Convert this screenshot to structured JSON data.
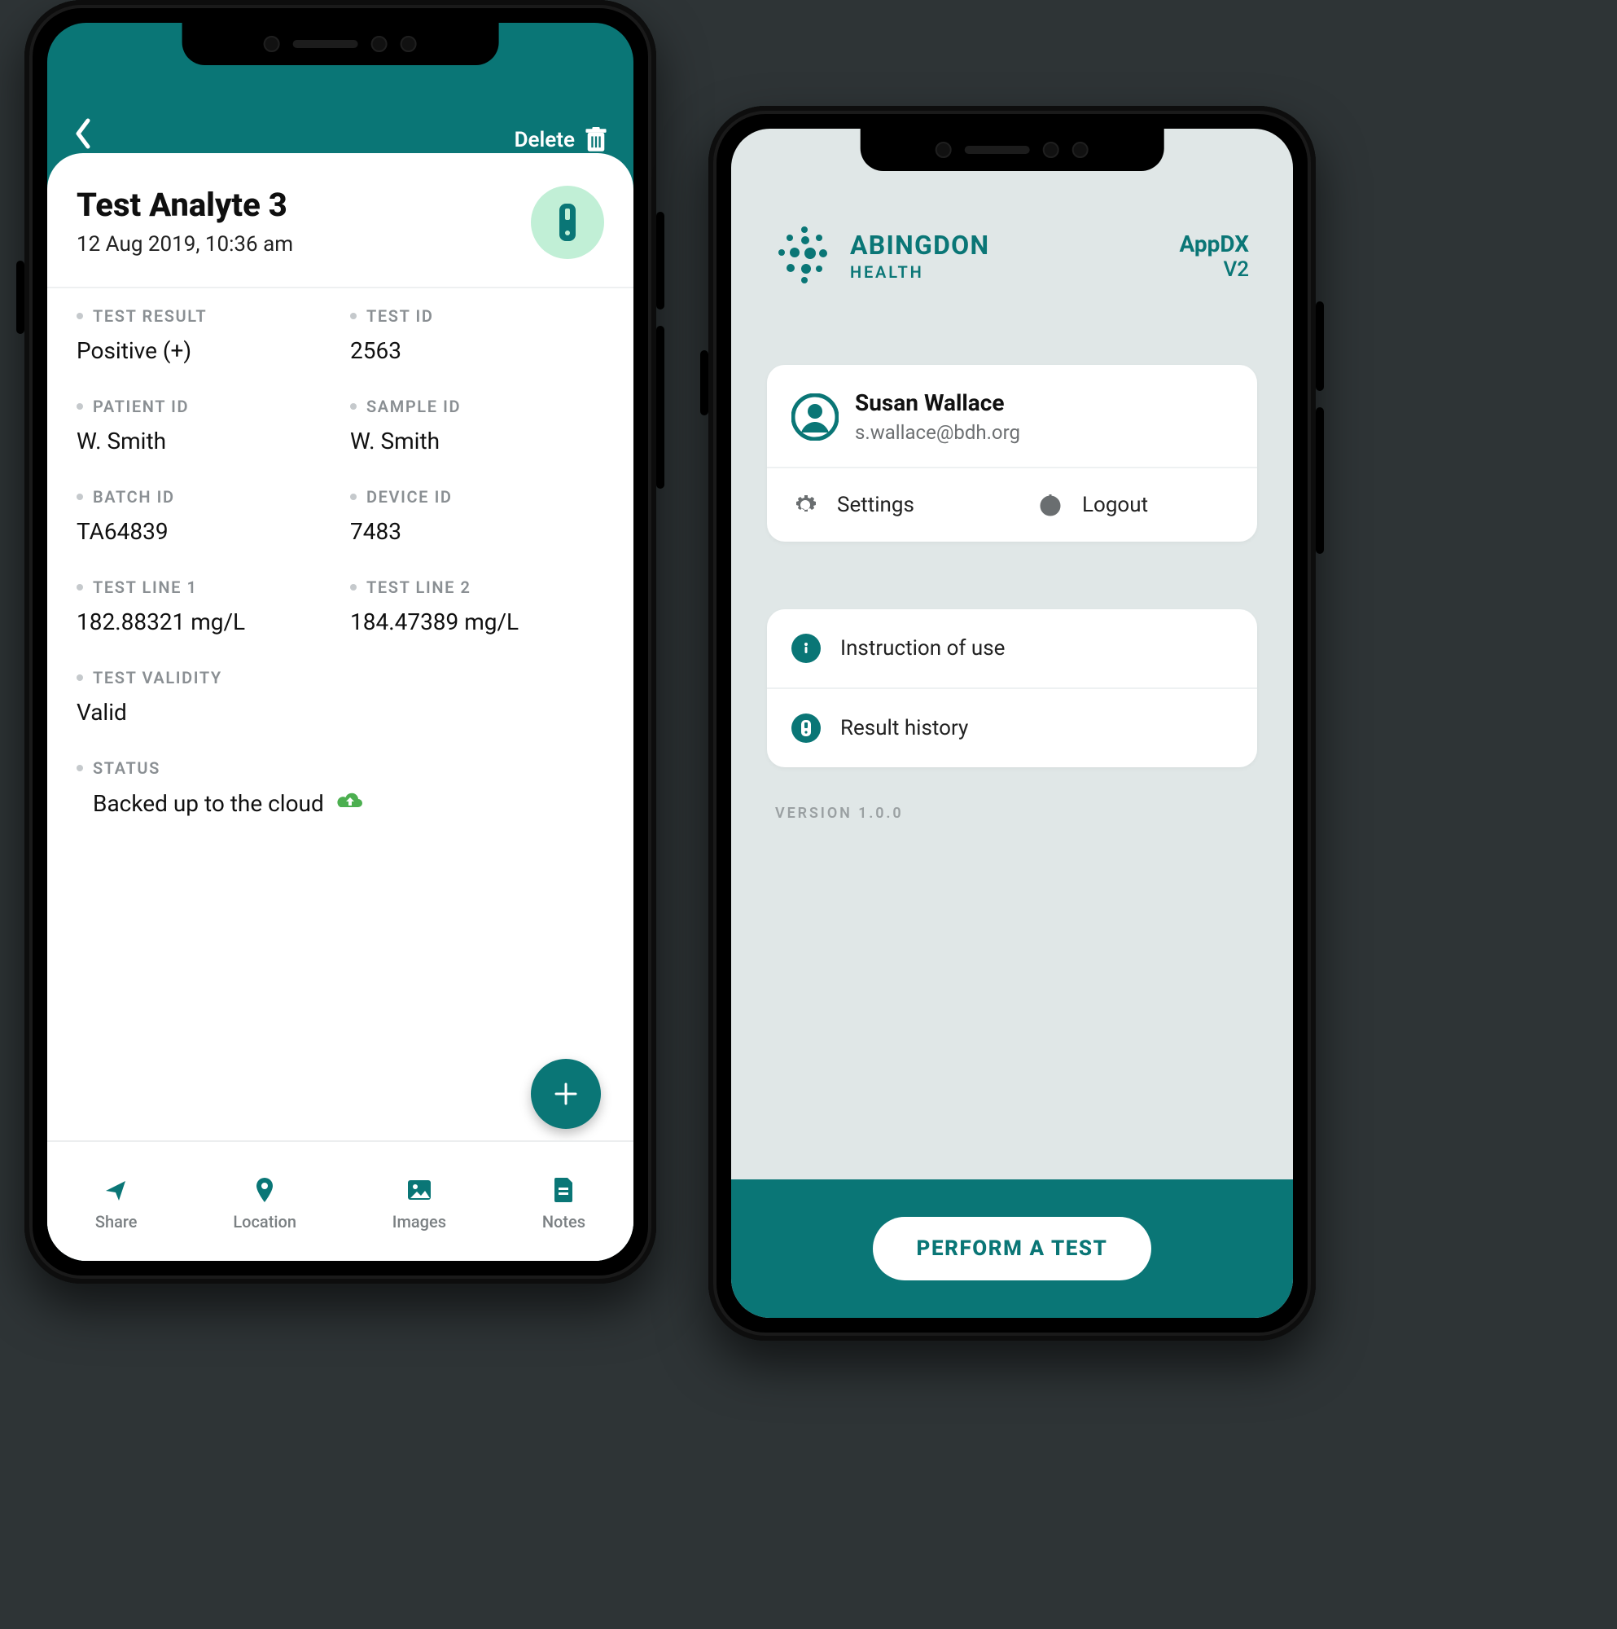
{
  "left": {
    "toolbar": {
      "delete_label": "Delete"
    },
    "header": {
      "title": "Test Analyte 3",
      "timestamp": "12 Aug 2019, 10:36 am"
    },
    "fields": {
      "test_result": {
        "label": "TEST RESULT",
        "value": "Positive (+)"
      },
      "test_id": {
        "label": "TEST ID",
        "value": "2563"
      },
      "patient_id": {
        "label": "PATIENT ID",
        "value": "W. Smith"
      },
      "sample_id": {
        "label": "SAMPLE ID",
        "value": "W. Smith"
      },
      "batch_id": {
        "label": "BATCH ID",
        "value": "TA64839"
      },
      "device_id": {
        "label": "DEVICE ID",
        "value": "7483"
      },
      "test_line_1": {
        "label": "TEST LINE 1",
        "value": "182.88321 mg/L"
      },
      "test_line_2": {
        "label": "TEST LINE 2",
        "value": "184.47389 mg/L"
      },
      "test_validity": {
        "label": "TEST VALIDITY",
        "value": "Valid"
      },
      "status": {
        "label": "STATUS",
        "value": "Backed up to the cloud"
      }
    },
    "tabs": {
      "share": "Share",
      "location": "Location",
      "images": "Images",
      "notes": "Notes"
    }
  },
  "right": {
    "brand": {
      "line1": "ABINGDON",
      "line2": "HEALTH"
    },
    "app": {
      "name": "AppDX",
      "version_tag": "V2"
    },
    "profile": {
      "name": "Susan Wallace",
      "email": "s.wallace@bdh.org"
    },
    "settings_label": "Settings",
    "logout_label": "Logout",
    "instruction_label": "Instruction of use",
    "history_label": "Result history",
    "version_line": "VERSION 1.0.0",
    "cta": "PERFORM A TEST"
  },
  "colors": {
    "teal": "#0a7676",
    "mint": "#c1efd6",
    "cloud_green": "#4CAF50"
  }
}
